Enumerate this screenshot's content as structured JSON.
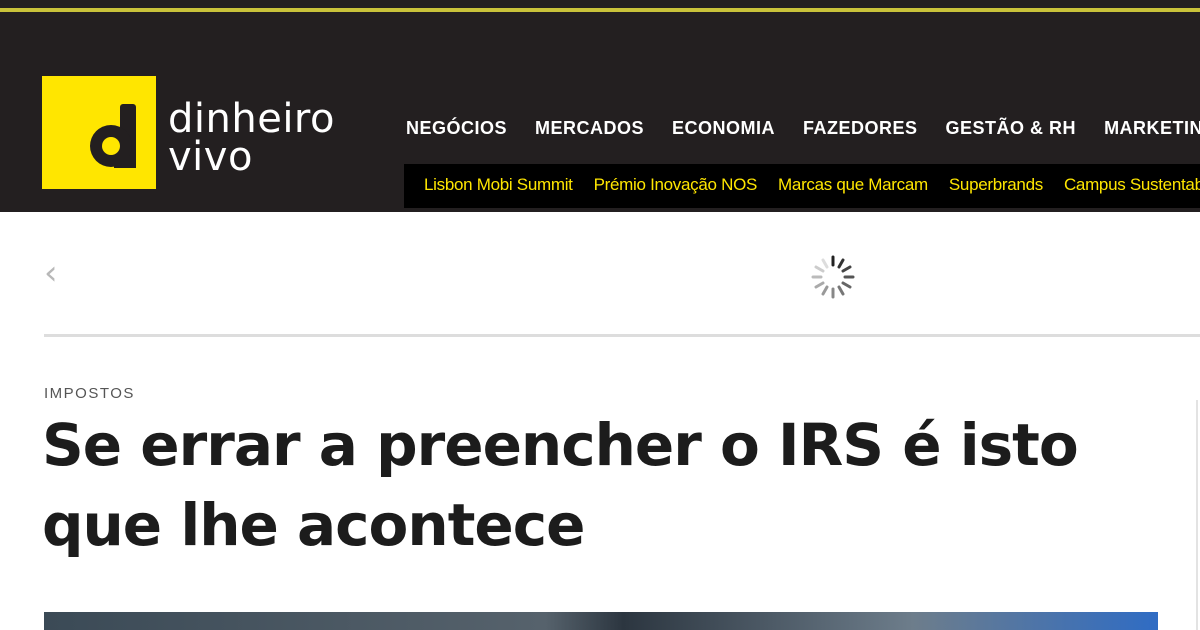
{
  "site": {
    "logo_line1": "dinheiro",
    "logo_line2": "vivo"
  },
  "nav": {
    "items": [
      {
        "label": "NEGÓCIOS"
      },
      {
        "label": "MERCADOS"
      },
      {
        "label": "ECONOMIA"
      },
      {
        "label": "FAZEDORES"
      },
      {
        "label": "GESTÃO & RH"
      },
      {
        "label": "MARKETING"
      }
    ]
  },
  "subnav": {
    "items": [
      {
        "label": "Lisbon Mobi Summit"
      },
      {
        "label": "Prémio Inovação NOS"
      },
      {
        "label": "Marcas que Marcam"
      },
      {
        "label": "Superbrands"
      },
      {
        "label": "Campus Sustentabilidade"
      }
    ]
  },
  "carousel": {
    "prev_icon": "‹"
  },
  "article": {
    "category": "IMPOSTOS",
    "title": "Se errar a preencher o IRS é isto que lhe acontece"
  },
  "colors": {
    "header_bg": "#231f20",
    "brand_yellow": "#ffe600",
    "accent_line": "#c9c23a"
  },
  "icons": {
    "logo": "dinheiro-vivo-logo-icon",
    "carousel_prev": "chevron-left-icon",
    "loading": "loading-spinner-icon"
  }
}
